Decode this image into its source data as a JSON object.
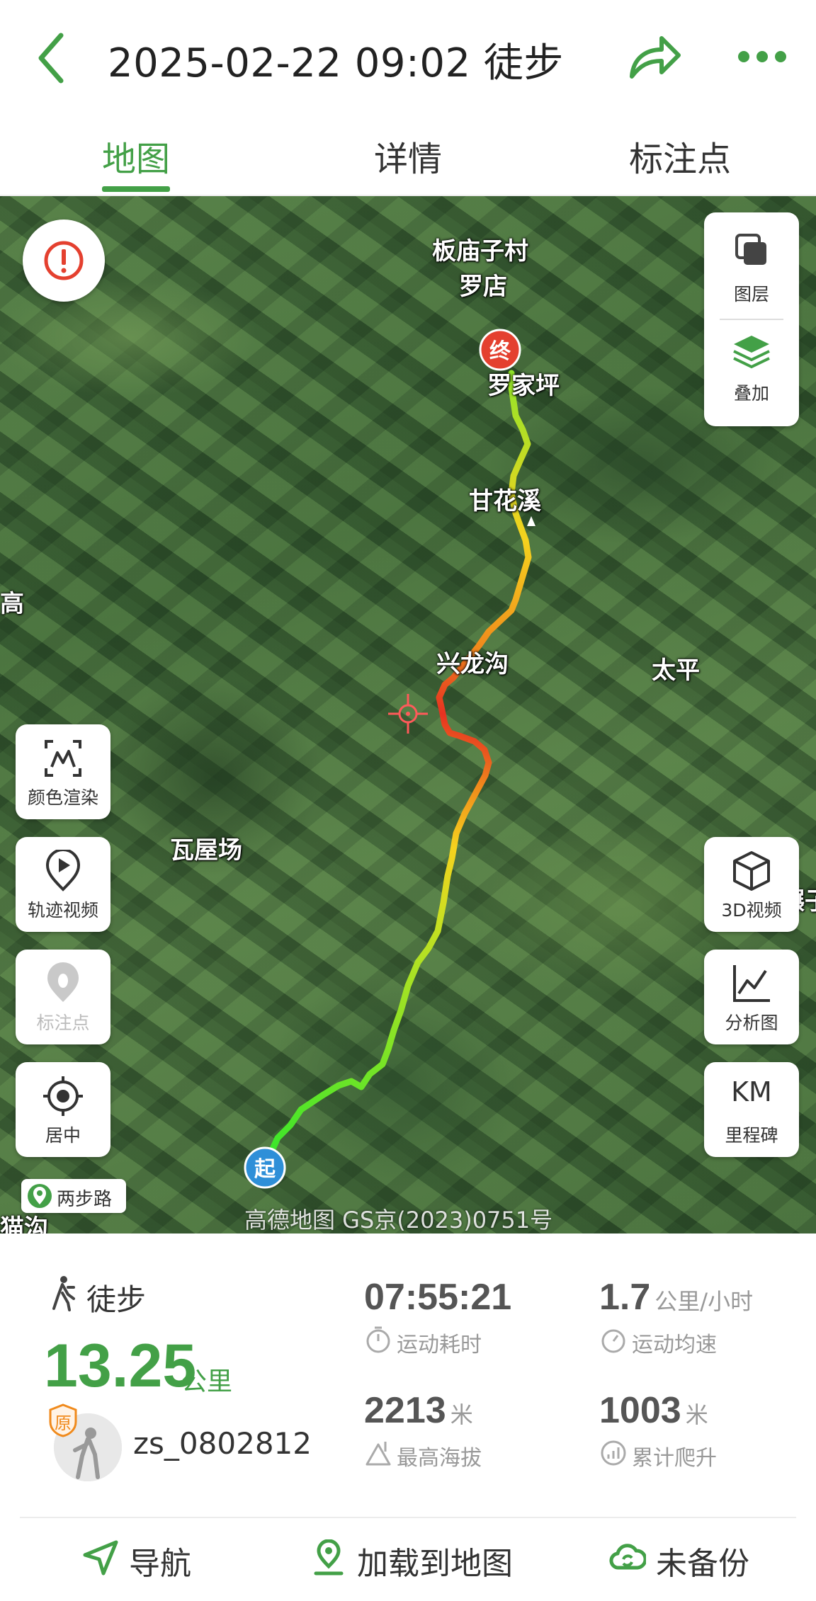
{
  "header": {
    "title": "2025-02-22 09:02 徒步"
  },
  "tabs": [
    {
      "label": "地图",
      "active": true
    },
    {
      "label": "详情",
      "active": false
    },
    {
      "label": "标注点",
      "active": false
    }
  ],
  "map": {
    "places": [
      "板庙子村",
      "罗店",
      "罗家坪",
      "甘花溪",
      "兴龙沟",
      "太平",
      "瓦屋场",
      "高",
      "碾子",
      "猫沟"
    ],
    "start_marker": "起",
    "end_marker": "终",
    "credit": "高德地图 GS京(2023)0751号",
    "brand_tag": "两步路",
    "controls_right": {
      "layers": "图层",
      "overlay": "叠加",
      "view_3d": "3D视频",
      "analysis": "分析图",
      "km_title": "KM",
      "milestones": "里程碑"
    },
    "controls_left": {
      "color_render": "颜色渲染",
      "track_video": "轨迹视频",
      "waypoints": "标注点",
      "center": "居中"
    },
    "icons": [
      "warning-icon",
      "layers-icon",
      "overlay-icon",
      "cube-icon",
      "chart-icon",
      "color-render-icon",
      "play-icon",
      "footprint-icon",
      "locate-icon",
      "crosshair-icon"
    ]
  },
  "stats": {
    "activity_type": "徒步",
    "distance": "13.25",
    "distance_unit": "公里",
    "username": "zs_0802812",
    "badge": "原",
    "duration": {
      "value": "07:55:21",
      "label": "运动耗时"
    },
    "avg_speed": {
      "value": "1.7",
      "unit": "公里/小时",
      "label": "运动均速"
    },
    "max_altitude": {
      "value": "2213",
      "unit": "米",
      "label": "最高海拔"
    },
    "total_ascent": {
      "value": "1003",
      "unit": "米",
      "label": "累计爬升"
    }
  },
  "bottom_bar": {
    "navigate": "导航",
    "load_to_map": "加载到地图",
    "backup": "未备份"
  },
  "colors": {
    "accent": "#43a047",
    "track_low": "#39e62a",
    "track_mid": "#f5d21e",
    "track_high": "#e63221",
    "start_marker": "#2e8fd8",
    "end_marker": "#e4402f"
  }
}
